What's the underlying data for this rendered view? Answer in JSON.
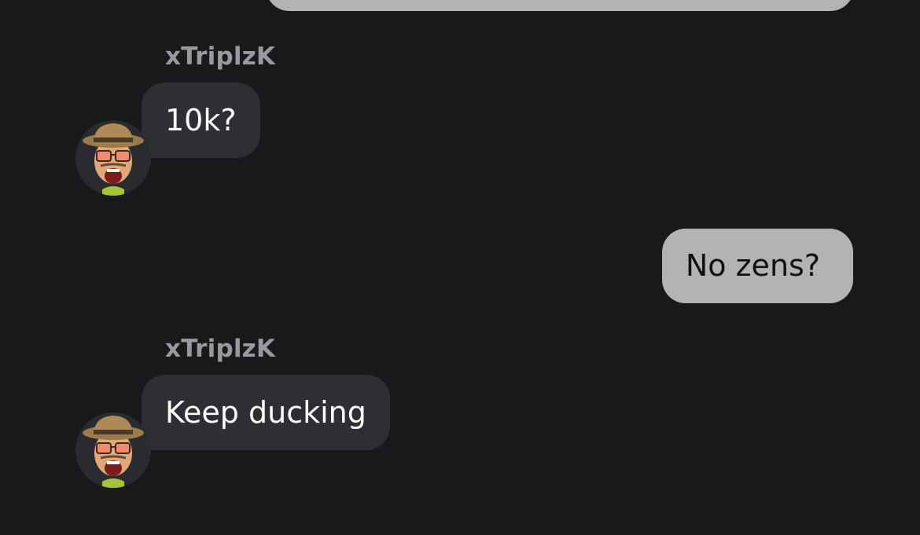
{
  "messages": [
    {
      "sender": "xTriplzK",
      "text": "10k?",
      "direction": "incoming",
      "avatar_icon": "memoji-hat-sunglasses-icon"
    },
    {
      "text": "No zens?",
      "direction": "outgoing"
    },
    {
      "sender": "xTriplzK",
      "text": "Keep ducking",
      "direction": "incoming",
      "avatar_icon": "memoji-hat-sunglasses-icon"
    }
  ],
  "colors": {
    "background": "#18191b",
    "incoming_bubble": "#2e2f32",
    "outgoing_bubble": "#b3b3b3",
    "sender_name": "#9a9a9e"
  }
}
